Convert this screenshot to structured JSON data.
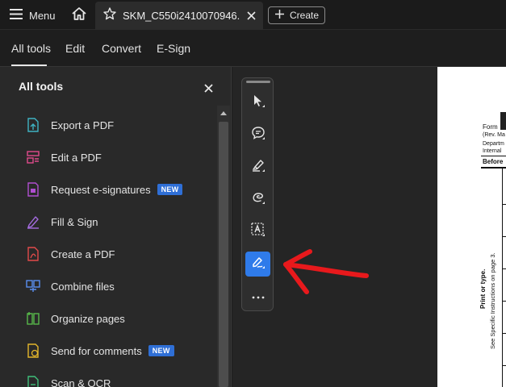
{
  "titlebar": {
    "menu_label": "Menu",
    "tab_title": "SKM_C550i2410070946...",
    "create_label": "Create"
  },
  "menubar": {
    "tabs": [
      {
        "label": "All tools",
        "active": true
      },
      {
        "label": "Edit"
      },
      {
        "label": "Convert"
      },
      {
        "label": "E-Sign"
      }
    ]
  },
  "panel": {
    "title": "All tools",
    "items": [
      {
        "label": "Export a PDF",
        "icon": "export-pdf-icon",
        "color": "#3fb3c3"
      },
      {
        "label": "Edit a PDF",
        "icon": "edit-pdf-icon",
        "color": "#e04a8c"
      },
      {
        "label": "Request e-signatures",
        "icon": "request-signature-icon",
        "color": "#b04fd0",
        "badge": "NEW"
      },
      {
        "label": "Fill & Sign",
        "icon": "fill-sign-icon",
        "color": "#a56ce0"
      },
      {
        "label": "Create a PDF",
        "icon": "create-pdf-icon",
        "color": "#e24b4b"
      },
      {
        "label": "Combine files",
        "icon": "combine-files-icon",
        "color": "#5a8ff0"
      },
      {
        "label": "Organize pages",
        "icon": "organize-pages-icon",
        "color": "#57b84a"
      },
      {
        "label": "Send for comments",
        "icon": "send-comments-icon",
        "color": "#e3b62b",
        "badge": "NEW"
      },
      {
        "label": "Scan & OCR",
        "icon": "scan-ocr-icon",
        "color": "#3fbf7a"
      }
    ]
  },
  "quick_toolbar": {
    "tools": [
      "select-cursor-icon",
      "add-comment-icon",
      "highlight-icon",
      "draw-freehand-icon",
      "text-recognition-icon",
      "sign-pen-icon"
    ],
    "active": "sign-pen-icon",
    "accent": "#2f7bea"
  },
  "annotation": {
    "color": "#e8191c"
  },
  "document": {
    "lines": [
      "Form",
      "(Rev. Ma",
      "Departm",
      "Internal",
      "Before",
      "Print or type.",
      "See Specific Instructions on page 3."
    ]
  }
}
